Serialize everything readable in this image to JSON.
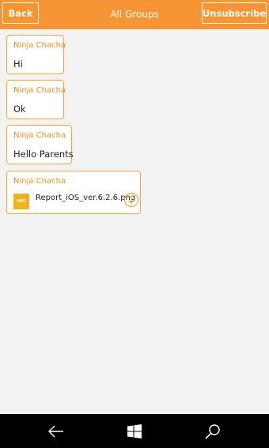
{
  "header": {
    "back_label": "Back",
    "title": "All Groups",
    "unsubscribe_label": "Unsubscribe",
    "background_color": "#f79433"
  },
  "messages": [
    {
      "sender": "Ninja Chacha",
      "text": "Hi"
    },
    {
      "sender": "Ninja Chacha",
      "text": "Ok"
    },
    {
      "sender": "Ninja Chacha",
      "text": "Hello Parents"
    },
    {
      "sender": "Ninja Chacha",
      "attachment": {
        "icon_label": "IMG",
        "file_name": "Report_iOS_ver.6.2.6.png",
        "action_icon": "download-icon"
      }
    }
  ],
  "accent_color": "#f7a23e",
  "nav_bar": {
    "buttons": [
      "back-arrow-icon",
      "windows-start-icon",
      "search-icon"
    ]
  }
}
